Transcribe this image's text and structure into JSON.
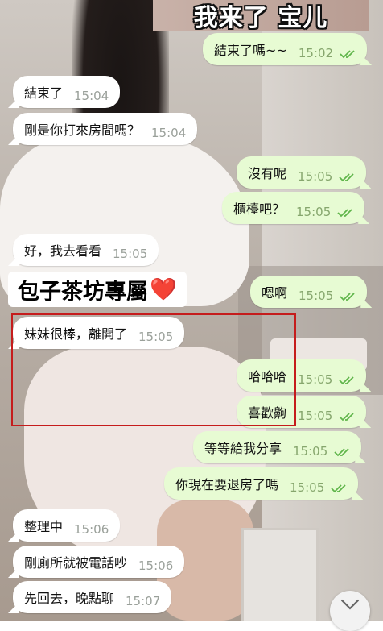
{
  "sticker": {
    "text": "我来了 宝儿"
  },
  "caption": {
    "text": "包子茶坊專屬",
    "heart": "❤️"
  },
  "messages": [
    {
      "dir": "out",
      "text": "結束了嗎~~",
      "time": "15:02"
    },
    {
      "dir": "in",
      "text": "結束了",
      "time": "15:04"
    },
    {
      "dir": "in",
      "text": "剛是你打來房間嗎？",
      "time": "15:04"
    },
    {
      "dir": "out",
      "text": "沒有呢",
      "time": "15:05"
    },
    {
      "dir": "out",
      "text": "櫃檯吧？",
      "time": "15:05"
    },
    {
      "dir": "in",
      "text": "好，我去看看",
      "time": "15:05"
    },
    {
      "dir": "out",
      "text": "嗯啊",
      "time": "15:05"
    },
    {
      "dir": "in",
      "text": "妹妹很棒，離開了",
      "time": "15:05"
    },
    {
      "dir": "out",
      "text": "哈哈哈",
      "time": "15:05"
    },
    {
      "dir": "out",
      "text": "喜歡齁",
      "time": "15:05"
    },
    {
      "dir": "out",
      "text": "等等給我分享",
      "time": "15:05"
    },
    {
      "dir": "out",
      "text": "你現在要退房了嗎",
      "time": "15:05"
    },
    {
      "dir": "in",
      "text": "整理中",
      "time": "15:06"
    },
    {
      "dir": "in",
      "text": "剛廁所就被電話吵",
      "time": "15:06"
    },
    {
      "dir": "in",
      "text": "先回去，晚點聊",
      "time": "15:07"
    }
  ],
  "icons": {
    "read": "double-check-icon",
    "scroll": "chevron-down-icon"
  },
  "colors": {
    "out_bubble": "#e7fbd3",
    "in_bubble": "#ffffff",
    "ticks": "#5fb54a",
    "highlight": "#c51c1c"
  }
}
